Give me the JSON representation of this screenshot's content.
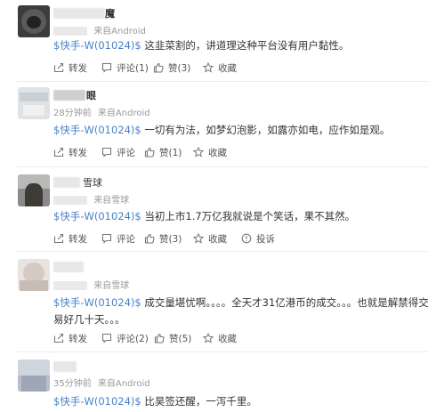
{
  "comments": [
    {
      "name_visible": "魔",
      "meta_time": "",
      "meta_source": "来自Android",
      "stock_tag": "$快手-W(01024)$",
      "text": "这韭菜割的，讲道理这种平台没有用户黏性。",
      "actions": {
        "repost": "转发",
        "comment": "评论(1)",
        "like": "赞(3)",
        "favorite": "收藏"
      }
    },
    {
      "name_visible": "眼",
      "meta_time": "28分钟前",
      "meta_source": "来自Android",
      "stock_tag": "$快手-W(01024)$",
      "text": "一切有为法，如梦幻泡影，如露亦如电，应作如是观。",
      "actions": {
        "repost": "转发",
        "comment": "评论",
        "like": "赞(1)",
        "favorite": "收藏"
      }
    },
    {
      "name_visible": "雪球",
      "meta_time": "",
      "meta_source": "来自雪球",
      "stock_tag": "$快手-W(01024)$",
      "text": "当初上市1.7万亿我就说是个笑话，果不其然。",
      "actions": {
        "repost": "转发",
        "comment": "评论",
        "like": "赞(3)",
        "favorite": "收藏",
        "report": "投诉"
      }
    },
    {
      "name_visible": "",
      "meta_time": "",
      "meta_source": "来自雪球",
      "stock_tag": "$快手-W(01024)$",
      "text_line1": "成交量堪忧啊。。。。全天才31亿港币的成交。。。也就是解禁得交",
      "text_line2": "易好几十天。。。",
      "actions": {
        "repost": "转发",
        "comment": "评论(2)",
        "like": "赞(5)",
        "favorite": "收藏"
      }
    },
    {
      "name_visible": "",
      "meta_time": "35分钟前",
      "meta_source": "来自Android",
      "stock_tag": "$快手-W(01024)$",
      "text": "比昊签还醒，一泻千里。"
    }
  ],
  "colors": {
    "stock_link": "#4a7fc7",
    "text": "#333333",
    "meta": "#9a9a9a",
    "separator": "#ececec"
  },
  "icons": {
    "repost": "share-box-icon",
    "comment": "speech-bubble-icon",
    "like": "thumbs-up-icon",
    "favorite": "star-icon",
    "report": "warning-icon"
  }
}
